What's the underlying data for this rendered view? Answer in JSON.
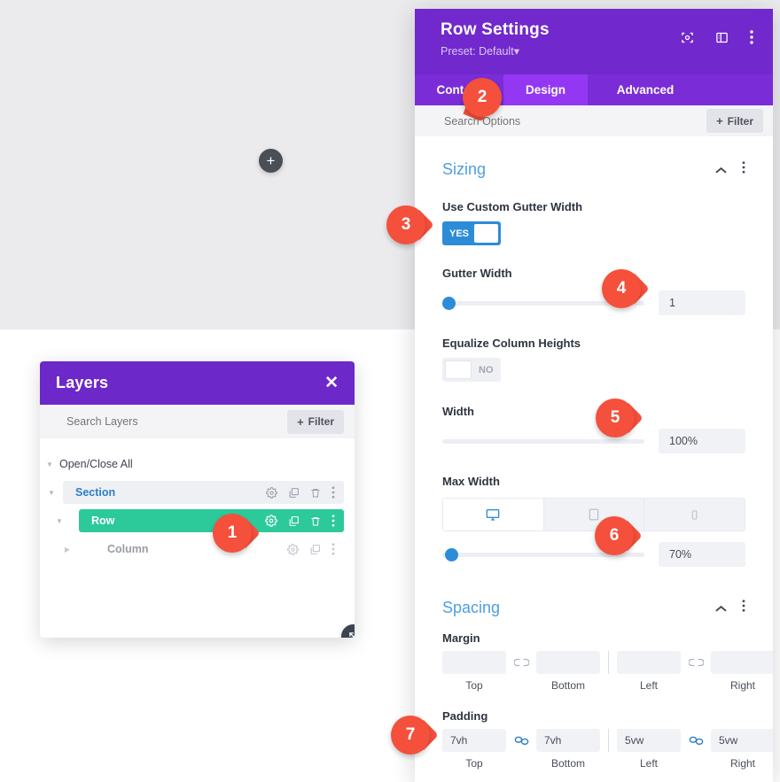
{
  "canvas": {
    "add_button": "+",
    "add_icon": "plus-icon"
  },
  "layers_panel": {
    "title": "Layers",
    "close_icon": "close-icon",
    "search_placeholder": "Search Layers",
    "search_value": "",
    "filter_label": "Filter",
    "filter_plus": "+",
    "open_close_all": "Open/Close All",
    "resize_icon": "resize-handle-icon",
    "items": [
      {
        "label": "Section",
        "icons": [
          "gear-icon",
          "duplicate-icon",
          "trash-icon",
          "more-icon"
        ]
      },
      {
        "label": "Row",
        "icons": [
          "gear-icon",
          "duplicate-icon",
          "trash-icon",
          "more-icon"
        ]
      },
      {
        "label": "Column",
        "icons": [
          "gear-icon",
          "duplicate-icon",
          "more-icon"
        ]
      }
    ]
  },
  "settings_panel": {
    "title": "Row Settings",
    "preset": "Preset: Default",
    "preset_caret": "▾",
    "header_icons": [
      "expand-icon",
      "layout-icon",
      "more-icon"
    ],
    "tabs": [
      {
        "label": "Content",
        "active": false
      },
      {
        "label": "Design",
        "active": true
      },
      {
        "label": "Advanced",
        "active": false
      }
    ],
    "search_placeholder": "Search Options",
    "search_value": "",
    "filter_label": "Filter",
    "filter_plus": "+",
    "sections": {
      "sizing": {
        "title": "Sizing",
        "collapse_icon": "chevron-up-icon",
        "more_icon": "more-icon",
        "use_custom_gutter_width": {
          "label": "Use Custom Gutter Width",
          "state": "YES"
        },
        "gutter_width": {
          "label": "Gutter Width",
          "value": "1",
          "slider_percent": 2
        },
        "equalize_column_heights": {
          "label": "Equalize Column Heights",
          "state": "NO"
        },
        "width": {
          "label": "Width",
          "value": "100%",
          "slider_percent": 100
        },
        "max_width": {
          "label": "Max Width",
          "value": "70%",
          "slider_percent": 3,
          "devices": [
            "desktop-icon",
            "tablet-icon",
            "phone-icon"
          ],
          "active_device": 0
        }
      },
      "spacing": {
        "title": "Spacing",
        "collapse_icon": "chevron-up-icon",
        "more_icon": "more-icon",
        "margin": {
          "label": "Margin",
          "link_icon": "link-broken-icon",
          "fields": [
            {
              "caption": "Top",
              "value": ""
            },
            {
              "caption": "Bottom",
              "value": ""
            },
            {
              "caption": "Left",
              "value": ""
            },
            {
              "caption": "Right",
              "value": ""
            }
          ]
        },
        "padding": {
          "label": "Padding",
          "link_icon": "link-connected-icon",
          "fields": [
            {
              "caption": "Top",
              "value": "7vh"
            },
            {
              "caption": "Bottom",
              "value": "7vh"
            },
            {
              "caption": "Left",
              "value": "5vw"
            },
            {
              "caption": "Right",
              "value": "5vw"
            }
          ]
        }
      }
    }
  },
  "callouts": [
    {
      "number": "1"
    },
    {
      "number": "2"
    },
    {
      "number": "3"
    },
    {
      "number": "4"
    },
    {
      "number": "5"
    },
    {
      "number": "6"
    },
    {
      "number": "7"
    }
  ],
  "colors": {
    "purple_header": "#7128cc",
    "purple_tabbar": "#7a2dd6",
    "purple_active_tab": "#9437f2",
    "layers_header": "#6d28c9",
    "accent_blue": "#2d8cd8",
    "section_title_blue": "#4e9fe0",
    "row_green": "#2cc99b",
    "callout_red": "#f4503c"
  }
}
